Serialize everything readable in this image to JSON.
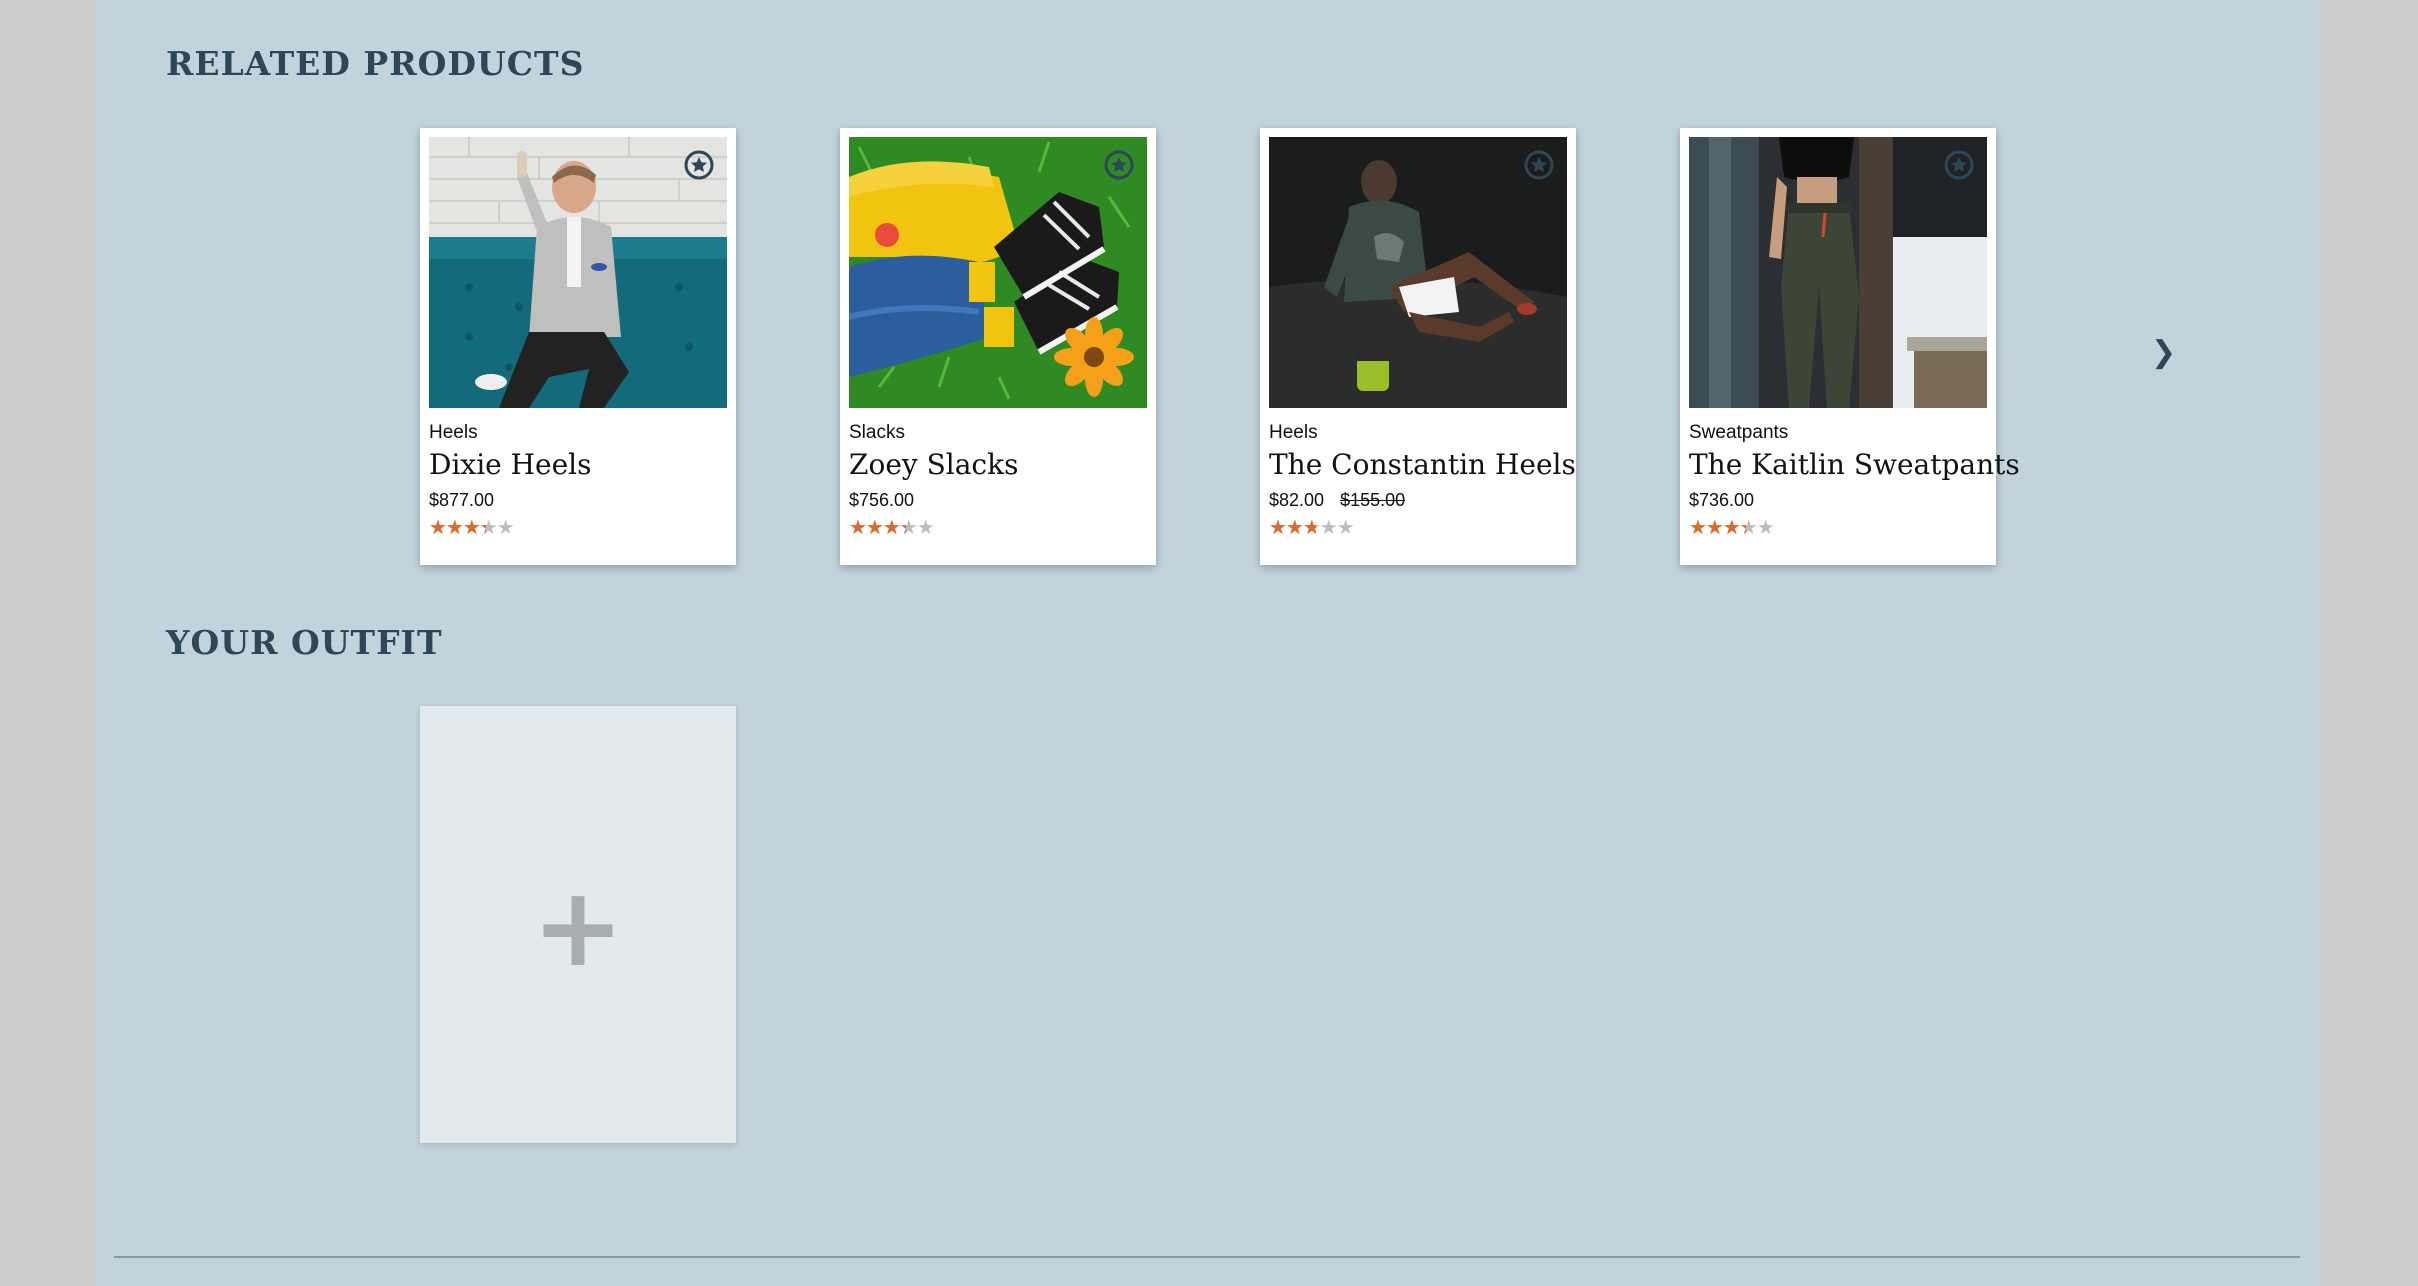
{
  "related": {
    "title": "RELATED PRODUCTS",
    "next_icon": "chevron-right-icon",
    "next_glyph": "❯",
    "products": [
      {
        "category": "Heels",
        "name": "Dixie Heels",
        "price": "$877.00",
        "original_price": "",
        "rating": 3,
        "max_rating": 5,
        "stars_base": "★★★★★",
        "stars_fill": "★★★★★",
        "action_icon": "star-circle-icon"
      },
      {
        "category": "Slacks",
        "name": "Zoey Slacks",
        "price": "$756.00",
        "original_price": "",
        "rating": 3,
        "max_rating": 5,
        "stars_base": "★★★★★",
        "stars_fill": "★★★★★",
        "action_icon": "star-circle-icon"
      },
      {
        "category": "Heels",
        "name": "The Constantin Heels",
        "price": "$82.00",
        "original_price": "$155.00",
        "rating": 2.5,
        "max_rating": 5,
        "stars_base": "★★★★★",
        "stars_fill": "★★★★★",
        "action_icon": "star-circle-icon"
      },
      {
        "category": "Sweatpants",
        "name": "The Kaitlin Sweatpants",
        "price": "$736.00",
        "original_price": "",
        "rating": 3,
        "max_rating": 5,
        "stars_base": "★★★★★",
        "stars_fill": "★★★★★",
        "action_icon": "star-circle-icon"
      }
    ]
  },
  "outfit": {
    "title": "YOUR OUTFIT",
    "add_icon": "plus-icon",
    "add_glyph": "+"
  },
  "colors": {
    "page_bg": "#c2d3dc",
    "heading": "#2f4656",
    "star_filled": "#dc6a2c",
    "star_empty": "#bdbdbd",
    "add_card_bg": "#e2eaee"
  }
}
